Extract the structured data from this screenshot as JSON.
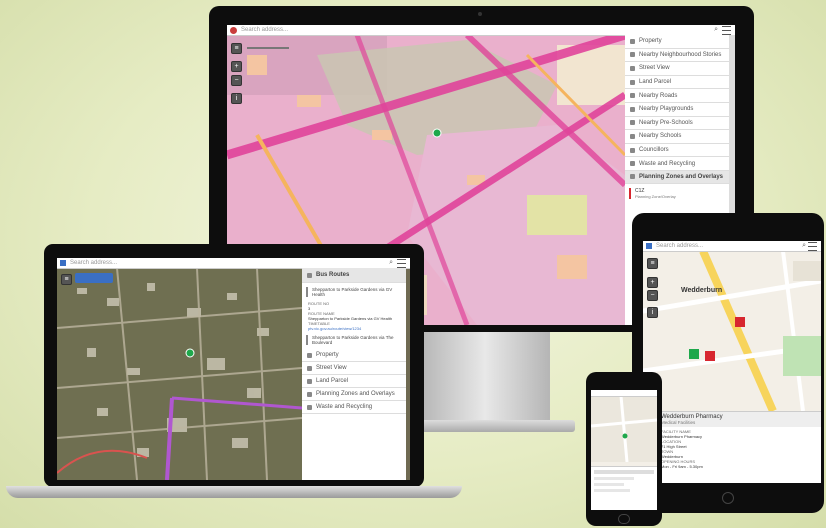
{
  "monitor": {
    "search_placeholder": "Search address...",
    "panel_items": [
      {
        "label": "Property",
        "icon": "home-icon"
      },
      {
        "label": "Nearby Neighbourhood Stories",
        "icon": "users-icon"
      },
      {
        "label": "Street View",
        "icon": "person-icon"
      },
      {
        "label": "Land Parcel",
        "icon": "parcel-icon"
      },
      {
        "label": "Nearby Roads",
        "icon": "road-icon"
      },
      {
        "label": "Nearby Playgrounds",
        "icon": "playground-icon"
      },
      {
        "label": "Nearby Pre-Schools",
        "icon": "pencil-icon"
      },
      {
        "label": "Nearby Schools",
        "icon": "school-icon"
      },
      {
        "label": "Councillors",
        "icon": "councillor-icon"
      },
      {
        "label": "Waste and Recycling",
        "icon": "bin-icon"
      }
    ],
    "planning_header": "Planning Zones and Overlays",
    "planning_code": "C1Z",
    "planning_sub": "Planning Zone/Overlay"
  },
  "laptop": {
    "search_placeholder": "Search address...",
    "bus_header": "Bus Routes",
    "route1": "Shepparton to Parkside Gardens via GV Health",
    "details": [
      {
        "label": "ROUTE NO",
        "value": "3"
      },
      {
        "label": "ROUTE NAME",
        "value": "Shepparton to Parkside Gardens via GV Health"
      },
      {
        "label": "TIMETABLE",
        "value": "ptv.vic.gov.au/route/view/1234"
      }
    ],
    "route2": "Shepparton to Parkside Gardens via The Boulevard",
    "panel_items": [
      {
        "label": "Property",
        "icon": "home-icon"
      },
      {
        "label": "Street View",
        "icon": "person-icon"
      },
      {
        "label": "Land Parcel",
        "icon": "parcel-icon"
      },
      {
        "label": "Planning Zones and Overlays",
        "icon": "layers-icon"
      },
      {
        "label": "Waste and Recycling",
        "icon": "bin-icon"
      }
    ]
  },
  "tablet": {
    "search_placeholder": "Search address...",
    "town_label": "Wedderburn",
    "result_title": "Wedderburn Pharmacy",
    "result_sub": "Medical Facilities",
    "fields": [
      {
        "label": "FACILITY NAME",
        "value": "Wedderburn Pharmacy"
      },
      {
        "label": "LOCATION",
        "value": "71 High Street"
      },
      {
        "label": "TOWN",
        "value": "Wedderburn"
      },
      {
        "label": "OPENING HOURS",
        "value": "Mon - Fri 9am - 5.30pm"
      }
    ]
  },
  "colors": {
    "zone_pink": "#e8a6c8",
    "road_magenta": "#e0449a",
    "accent_blue": "#3a6fc4",
    "marker_green": "#1ea84b",
    "marker_red": "#d7262f"
  }
}
